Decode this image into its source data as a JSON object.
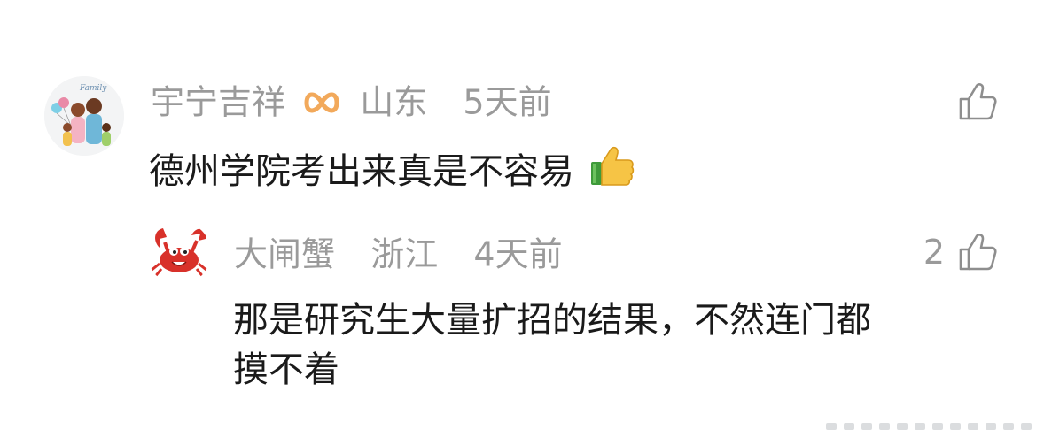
{
  "comments": [
    {
      "user": "宇宁吉祥",
      "location": "山东",
      "time": "5天前",
      "text": "德州学院考出来真是不容易",
      "likes": "",
      "badge_icon": "orange-infinity-badge-icon",
      "emoji_icon": "thumbs-up-emoji-icon"
    }
  ],
  "reply": {
    "user": "大闸蟹",
    "location": "浙江",
    "time": "4天前",
    "likes": "2",
    "text_line1": "那是研究生大量扩招的结果，不然连门都",
    "text_line2": "摸不着"
  },
  "colors": {
    "meta": "#9a9a9a",
    "text": "#1a1a1a",
    "badge": "#f2a95b",
    "crab": "#d8312a"
  }
}
